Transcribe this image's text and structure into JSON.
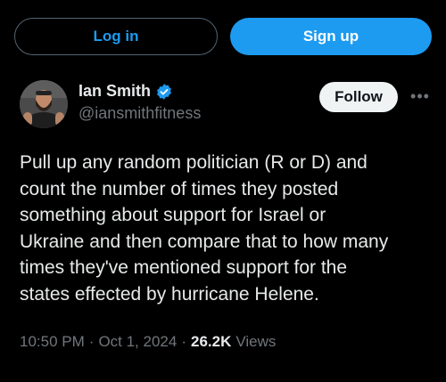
{
  "auth": {
    "login_label": "Log in",
    "signup_label": "Sign up"
  },
  "author": {
    "display_name": "Ian Smith",
    "handle": "@iansmithfitness",
    "verified": true
  },
  "actions": {
    "follow_label": "Follow",
    "more_icon": "more-horizontal-icon"
  },
  "tweet": {
    "text": "Pull up any random politician (R or D) and\ncount the number of times they posted\nsomething about support for Israel or\nUkraine and then compare that to how many\ntimes they've mentioned support for the\nstates effected by hurricane Helene."
  },
  "meta": {
    "time": "10:50 PM",
    "sep1": "·",
    "date": "Oct 1, 2024",
    "sep2": "·",
    "views_count": "26.2K",
    "views_label": "Views"
  },
  "colors": {
    "background": "#000000",
    "accent": "#1d9bf0",
    "text_primary": "#e7e9ea",
    "text_secondary": "#71767b"
  }
}
